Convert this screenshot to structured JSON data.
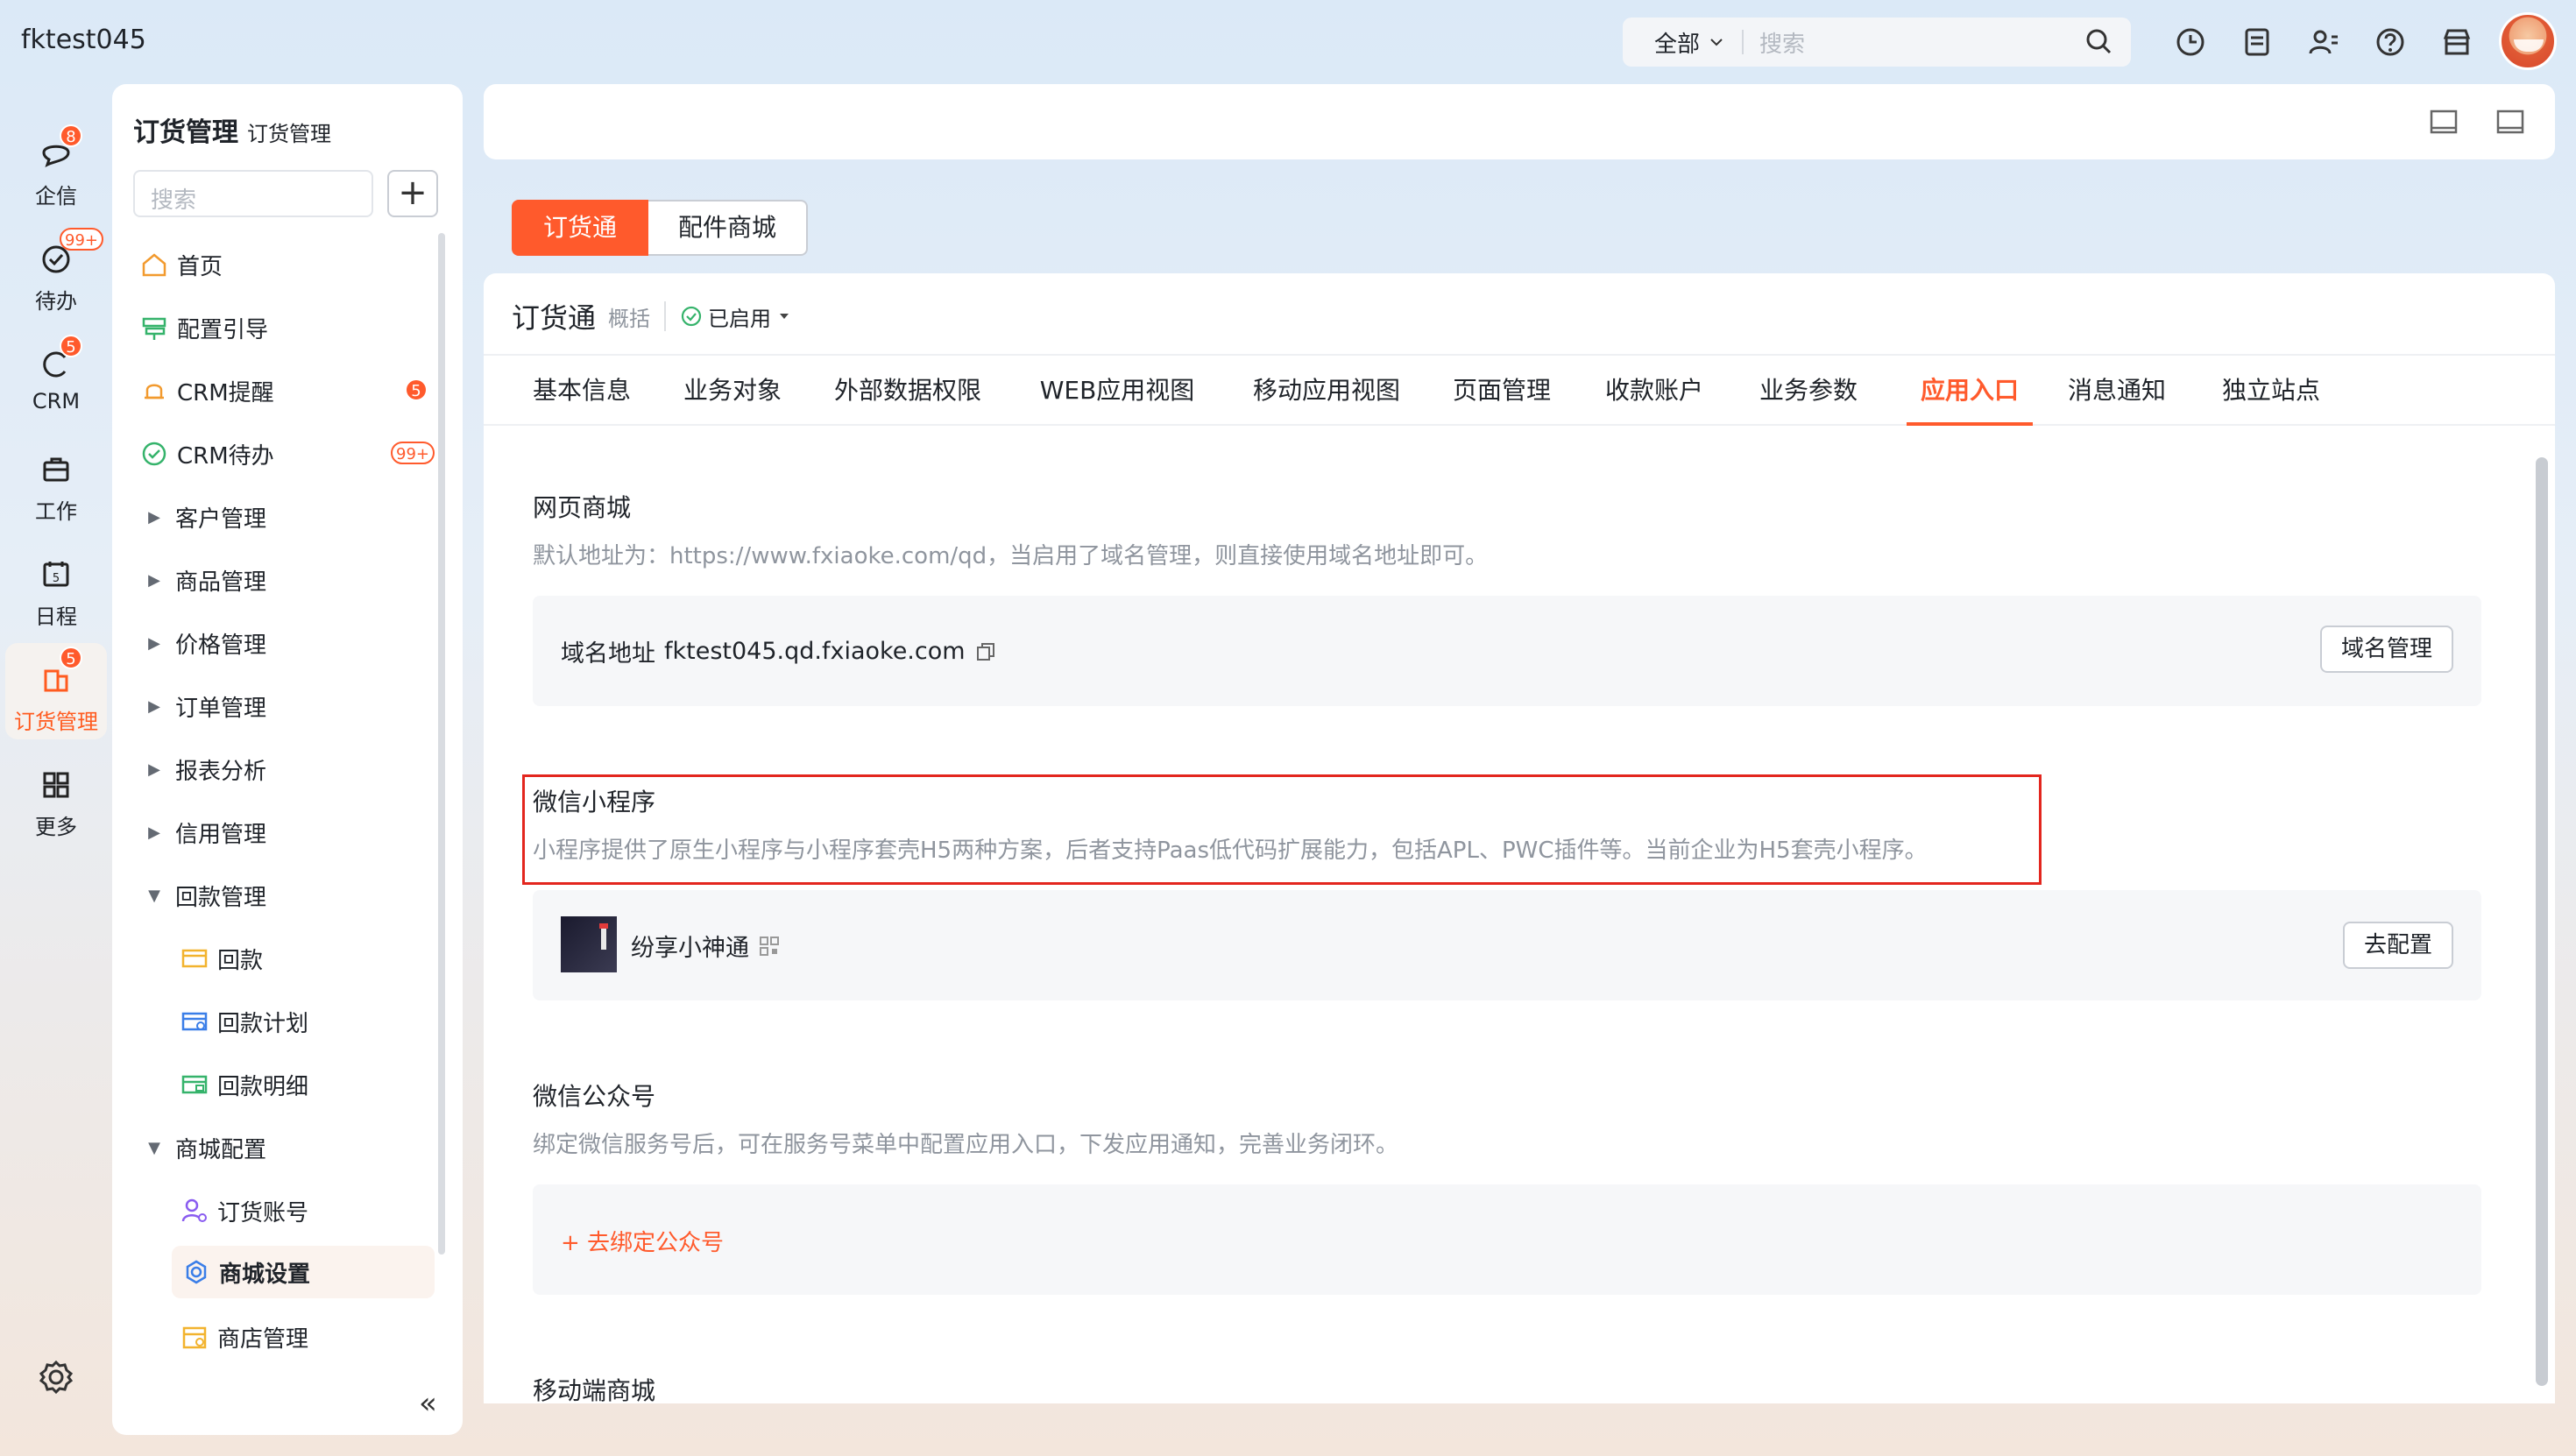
{
  "topbar": {
    "tenant": "fktest045",
    "scope": "全部",
    "search_placeholder": "搜索"
  },
  "rail": [
    {
      "label": "企信",
      "badge": "8",
      "icon": "chat-bubble-icon"
    },
    {
      "label": "待办",
      "badge": "99+",
      "icon": "check-circle-icon"
    },
    {
      "label": "CRM",
      "badge": "5",
      "icon": "crm-icon"
    },
    {
      "label": "工作",
      "badge": "",
      "icon": "briefcase-icon"
    },
    {
      "label": "日程",
      "badge": "",
      "icon": "calendar-icon"
    },
    {
      "label": "订货管理",
      "badge": "5",
      "icon": "order-manage-icon"
    },
    {
      "label": "更多",
      "badge": "",
      "icon": "grid-more-icon"
    }
  ],
  "sidebar": {
    "title": "订货管理",
    "subtitle": "订货管理",
    "search_placeholder": "搜索",
    "add": "+",
    "items": [
      {
        "label": "首页"
      },
      {
        "label": "配置引导"
      },
      {
        "label": "CRM提醒",
        "count": "5"
      },
      {
        "label": "CRM待办",
        "count": "99+"
      },
      {
        "label": "客户管理"
      },
      {
        "label": "商品管理"
      },
      {
        "label": "价格管理"
      },
      {
        "label": "订单管理"
      },
      {
        "label": "报表分析"
      },
      {
        "label": "信用管理"
      },
      {
        "label": "回款管理"
      },
      {
        "label": "回款"
      },
      {
        "label": "回款计划"
      },
      {
        "label": "回款明细"
      },
      {
        "label": "商城配置"
      },
      {
        "label": "订货账号"
      },
      {
        "label": "商城设置"
      },
      {
        "label": "商店管理"
      }
    ],
    "collapse": "«"
  },
  "segment": {
    "tab1": "订货通",
    "tab2": "配件商城"
  },
  "app": {
    "title": "订货通",
    "summary": "概括",
    "status": "已启用"
  },
  "tabs": [
    "基本信息",
    "业务对象",
    "外部数据权限",
    "WEB应用视图",
    "移动应用视图",
    "页面管理",
    "收款账户",
    "业务参数",
    "应用入口",
    "消息通知",
    "独立站点"
  ],
  "sections": {
    "web": {
      "title": "网页商城",
      "desc": "默认地址为：https://www.fxiaoke.com/qd，当启用了域名管理，则直接使用域名地址即可。",
      "domain_label": "域名地址",
      "domain_value": "fktest045.qd.fxiaoke.com",
      "button": "域名管理"
    },
    "mini": {
      "title": "微信小程序",
      "desc": "小程序提供了原生小程序与小程序套壳H5两种方案，后者支持Paas低代码扩展能力，包括APL、PWC插件等。当前企业为H5套壳小程序。",
      "app_name": "纷享小神通",
      "button": "去配置"
    },
    "mp": {
      "title": "微信公众号",
      "desc": "绑定微信服务号后，可在服务号菜单中配置应用入口，下发应用通知，完善业务闭环。",
      "link": "+ 去绑定公众号"
    },
    "mobile": {
      "title": "移动端商城"
    }
  },
  "colors": {
    "accent": "#ff5a2c",
    "highlight": "#e3261e"
  }
}
